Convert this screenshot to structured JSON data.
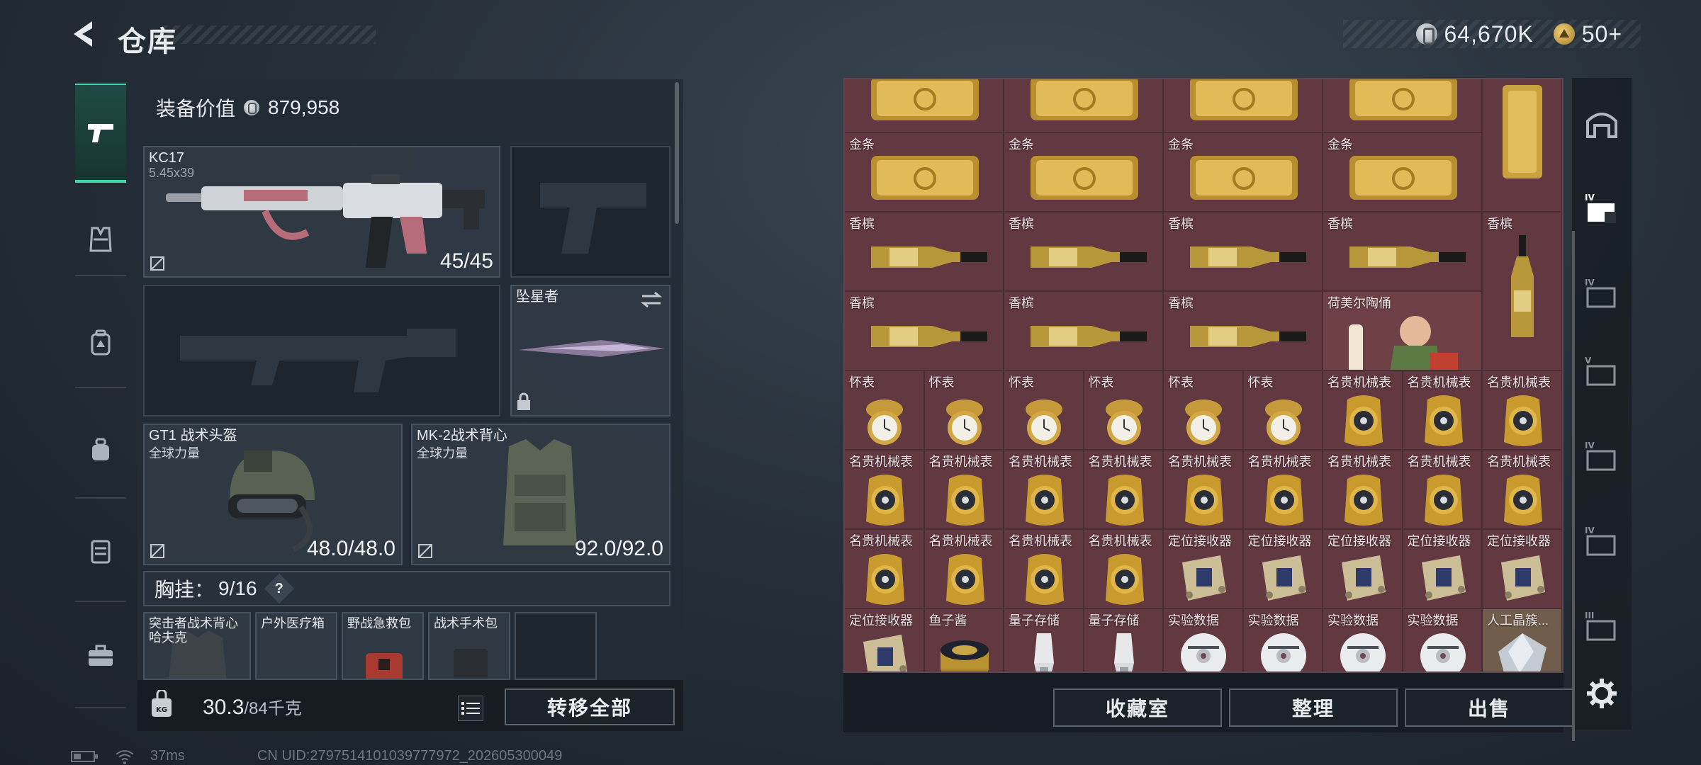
{
  "header": {
    "title": "仓库",
    "currency_a": "64,670K",
    "currency_b": "50+"
  },
  "loadout": {
    "equip_value_label": "装备价值",
    "equip_value": "879,958",
    "primary": {
      "name": "KC17",
      "caliber": "5.45x39",
      "ammo": "45/45"
    },
    "melee": {
      "name": "坠星者"
    },
    "helmet": {
      "name": "GT1 战术头盔",
      "faction": "全球力量",
      "durability": "48.0/48.0"
    },
    "armor": {
      "name": "MK-2战术背心",
      "faction": "全球力量",
      "durability": "92.0/92.0"
    },
    "chest_rig": {
      "label": "胸挂：",
      "count": "9/16",
      "help": "?"
    },
    "chest_items": [
      {
        "name": "突击者战术背心",
        "sub": "哈夫克"
      },
      {
        "name": "户外医疗箱"
      },
      {
        "name": "野战急救包"
      },
      {
        "name": "战术手术包"
      }
    ],
    "weight": {
      "current": "30.3",
      "max": "/84千克"
    },
    "transfer_all": "转移全部"
  },
  "stash": {
    "rows": [
      [
        "金条",
        "金条",
        "金条",
        "金条",
        ""
      ],
      [
        "香槟",
        "香槟",
        "香槟",
        "香槟",
        "香槟"
      ],
      [
        "香槟",
        "香槟",
        "香槟",
        "荷美尔陶俑",
        ""
      ],
      [
        "怀表",
        "怀表",
        "怀表",
        "怀表",
        "怀表",
        "怀表",
        "名贵机械表",
        "名贵机械表",
        "名贵机械表"
      ],
      [
        "名贵机械表",
        "名贵机械表",
        "名贵机械表",
        "名贵机械表",
        "名贵机械表",
        "名贵机械表",
        "名贵机械表",
        "名贵机械表",
        "名贵机械表"
      ],
      [
        "名贵机械表",
        "名贵机械表",
        "名贵机械表",
        "名贵机械表",
        "定位接收器",
        "定位接收器",
        "定位接收器",
        "定位接收器",
        "定位接收器"
      ],
      [
        "定位接收器",
        "鱼子酱",
        "量子存储",
        "量子存储",
        "实验数据",
        "实验数据",
        "实验数据",
        "实验数据",
        "人工晶簇..."
      ]
    ],
    "buttons": {
      "collection": "收藏室",
      "organize": "整理",
      "sell": "出售"
    }
  },
  "status": {
    "ping": "37ms",
    "uid": "CN UID:2797514101039777972_202605300049"
  },
  "colors": {
    "accent": "#3fd6a8",
    "stash_bg": "#563742"
  }
}
